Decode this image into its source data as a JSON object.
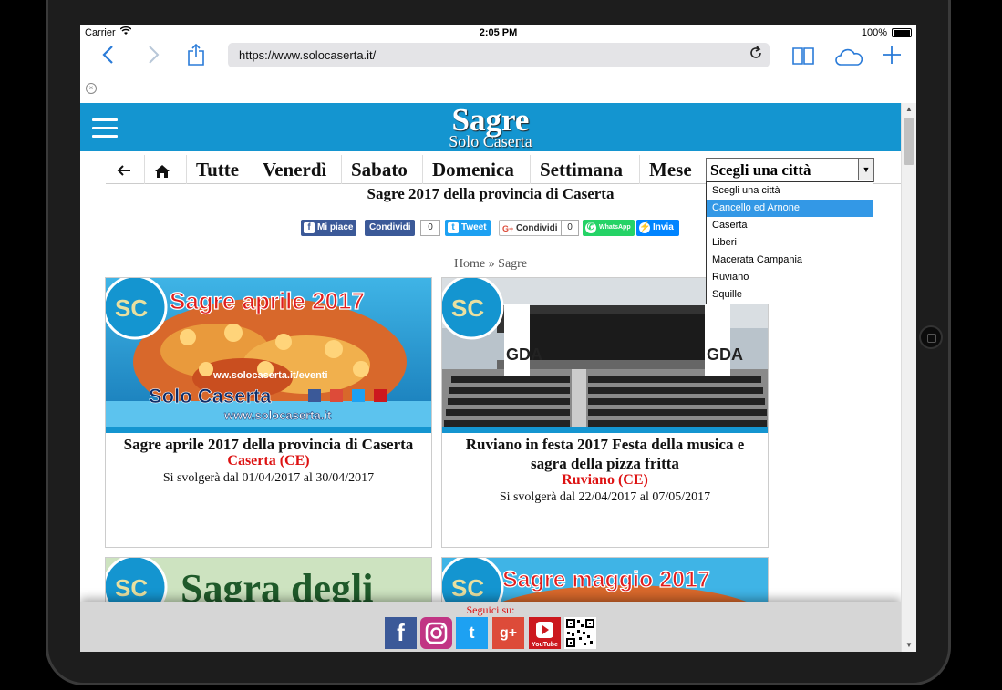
{
  "status_bar": {
    "carrier": "Carrier",
    "time": "2:05 PM",
    "battery": "100%"
  },
  "browser": {
    "url": "https://www.solocaserta.it/",
    "icons": [
      "back-icon",
      "forward-icon",
      "share-icon",
      "reload-icon",
      "bookmarks-icon",
      "cloud-icon",
      "new-tab-icon",
      "close-tab-icon"
    ]
  },
  "site": {
    "logo_line1": "Sagre",
    "logo_line2": "Solo Caserta"
  },
  "nav": {
    "items": [
      "Tutte",
      "Venerdì",
      "Sabato",
      "Domenica",
      "Settimana",
      "Mese"
    ],
    "city_select": {
      "selected": "Scegli una città",
      "options": [
        "Scegli una città",
        "Cancello ed Arnone",
        "Caserta",
        "Liberi",
        "Macerata Campania",
        "Ruviano",
        "Squille"
      ],
      "highlighted": "Cancello ed Arnone"
    }
  },
  "page_title": "Sagre 2017 della provincia di Caserta",
  "share": {
    "facebook": "Mi piace",
    "facebook_share": "Condividi",
    "facebook_count": "0",
    "twitter": "Tweet",
    "gplus": "Condividi",
    "gplus_count": "0",
    "whatsapp": "WhatsApp",
    "messenger": "Invia"
  },
  "breadcrumb": {
    "home": "Home",
    "sep": "»",
    "current": "Sagre"
  },
  "cards": [
    {
      "image_title": "Sagre aprile 2017",
      "image_url_text": "ww.solocaserta.it/eventi",
      "image_brand": "Solo Caserta",
      "image_site": "www.solocaserta.it",
      "title": "Sagre aprile 2017 della provincia di Caserta",
      "city": "Caserta (CE)",
      "dates": "Si svolgerà dal 01/04/2017 al 30/04/2017"
    },
    {
      "image_text": "GDA",
      "title": "Ruviano in festa 2017 Festa della musica e sagra della pizza fritta",
      "city": "Ruviano (CE)",
      "dates": "Si svolgerà dal 22/04/2017 al 07/05/2017"
    },
    {
      "image_title": "Sagra degli"
    },
    {
      "image_title": "Sagre maggio 2017"
    }
  ],
  "footer": {
    "follow": "Seguici su:",
    "youtube_label": "YouTube"
  },
  "colors": {
    "brand": "#1495d0",
    "city": "#dd1111",
    "facebook": "#3b5998",
    "twitter": "#1da1f2",
    "gplus": "#dd4b39",
    "whatsapp": "#25d366",
    "messenger": "#0084ff",
    "youtube": "#cc181e"
  }
}
